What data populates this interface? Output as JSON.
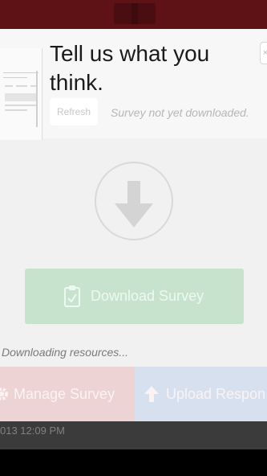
{
  "survey": {
    "title": "Tell us what you think.",
    "refresh_label": "Refresh",
    "status_note": "Survey not yet downloaded.",
    "download_label": "Download Survey",
    "progress_text": "Downloading resources..."
  },
  "actions": {
    "manage_label": "Manage Survey",
    "upload_label": "Upload Respon"
  },
  "footer": {
    "timestamp": "013 12:09 PM"
  },
  "colors": {
    "top_bar": "#5e1216",
    "download_button": "#c8e3cd",
    "manage_button": "#edd3d3",
    "upload_button": "#d6e0ef"
  }
}
